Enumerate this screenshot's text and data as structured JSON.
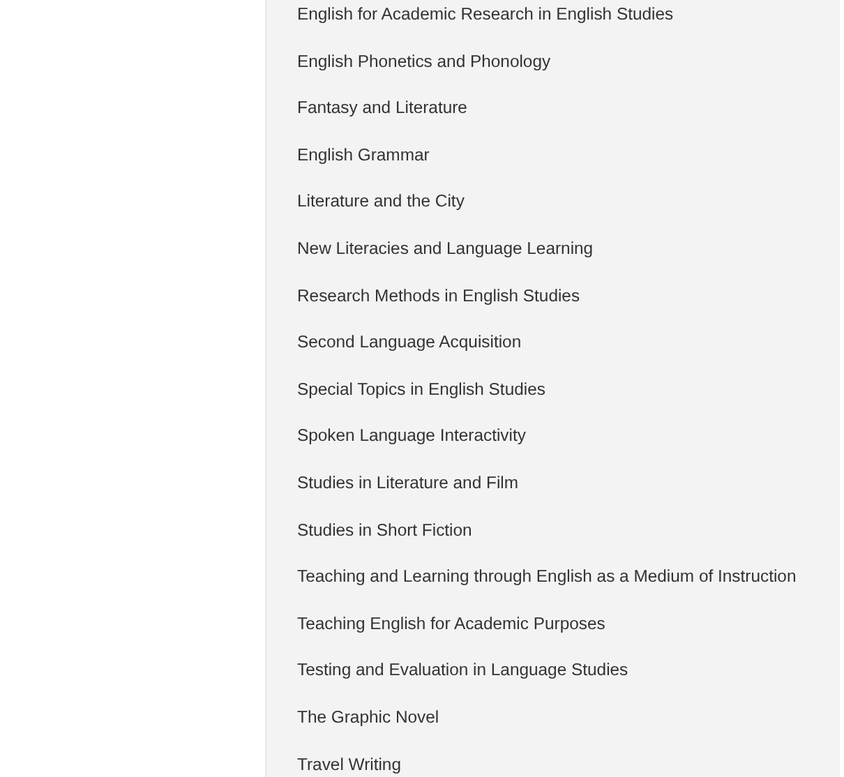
{
  "courses": [
    {
      "label": "English for Academic Research in English Studies"
    },
    {
      "label": "English Phonetics and Phonology"
    },
    {
      "label": "Fantasy and Literature"
    },
    {
      "label": "English Grammar"
    },
    {
      "label": "Literature and the City"
    },
    {
      "label": "New Literacies and Language Learning"
    },
    {
      "label": "Research Methods in English Studies"
    },
    {
      "label": "Second Language Acquisition"
    },
    {
      "label": "Special Topics in English Studies"
    },
    {
      "label": "Spoken Language Interactivity"
    },
    {
      "label": "Studies in Literature and Film"
    },
    {
      "label": "Studies in Short Fiction"
    },
    {
      "label": "Teaching and Learning through English as a Medium of Instruction"
    },
    {
      "label": "Teaching English for Academic Purposes"
    },
    {
      "label": "Testing and Evaluation in Language Studies"
    },
    {
      "label": "The Graphic Novel"
    },
    {
      "label": "Travel Writing"
    }
  ]
}
